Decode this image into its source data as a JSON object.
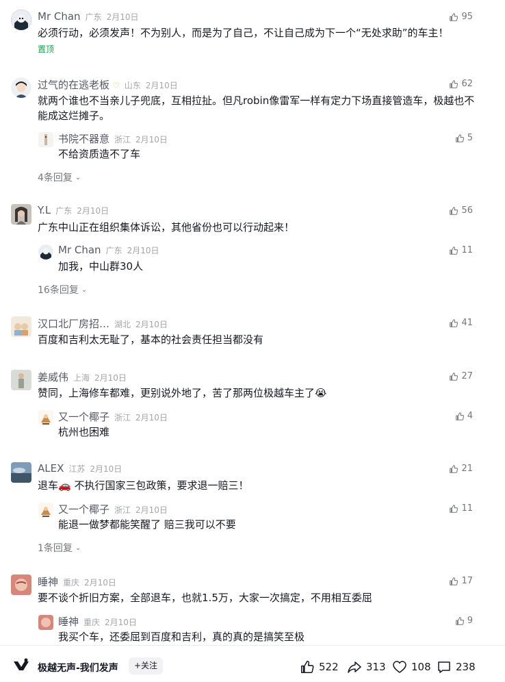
{
  "comments": [
    {
      "name": "Mr Chan",
      "location": "广东",
      "date": "2月10日",
      "likes": "95",
      "text": "必须行动，必须发声！不为别人，而是为了自己，不让自己成为下一个“无处求助”的车主！",
      "pinned": "置顶"
    },
    {
      "name": "过气的在逃老板",
      "location": "山东",
      "date": "2月10日",
      "likes": "62",
      "text": "就两个谁也不当亲儿子兜底，互相拉扯。但凡robin像雷军一样有定力下场直接管造车，极越也不能成这烂摊子。",
      "reply": {
        "name": "书院不器意",
        "location": "浙江",
        "date": "2月10日",
        "likes": "5",
        "text": "不给资质造不了车"
      },
      "more": "4条回复"
    },
    {
      "name": "Y.L",
      "location": "广东",
      "date": "2月10日",
      "likes": "56",
      "text": "广东中山正在组织集体诉讼，其他省份也可以行动起来！",
      "reply": {
        "name": "Mr Chan",
        "location": "广东",
        "date": "2月10日",
        "likes": "11",
        "text": "加我，中山群30人"
      },
      "more": "16条回复"
    },
    {
      "name": "汉口北厂房招…",
      "location": "湖北",
      "date": "2月10日",
      "likes": "41",
      "text": "百度和吉利太无耻了，基本的社会责任担当都没有"
    },
    {
      "name": "姜威伟",
      "location": "上海",
      "date": "2月10日",
      "likes": "27",
      "text": "赞同，上海修车都难，更别说外地了，苦了那两位极越车主了😭",
      "reply": {
        "name": "又一个椰子",
        "location": "浙江",
        "date": "2月10日",
        "likes": "4",
        "text": "杭州也困难"
      }
    },
    {
      "name": "ALEX",
      "location": "江苏",
      "date": "2月10日",
      "likes": "21",
      "text": "退车🚗 不执行国家三包政策，要求退一赔三！",
      "reply": {
        "name": "又一个椰子",
        "location": "浙江",
        "date": "2月10日",
        "likes": "11",
        "text": "能退一做梦都能笑醒了 赔三我可以不要"
      },
      "more": "1条回复"
    },
    {
      "name": "睡神",
      "location": "重庆",
      "date": "2月10日",
      "likes": "17",
      "text": "要不谈个折旧方案，全部退车，也就1.5万，大家一次搞定，不用相互委屈",
      "reply": {
        "name": "睡神",
        "location": "重庆",
        "date": "2月10日",
        "likes": "9",
        "text": "我买个车，还委屈到百度和吉利，真的真的是搞笑至极"
      }
    }
  ],
  "bottom_bar": {
    "title": "极越无声-我们发声",
    "follow_label": "+关注",
    "likes": "522",
    "shares": "313",
    "favorites": "108",
    "comments": "238"
  },
  "colors": {
    "pinned_green": "#0fa84a",
    "meta_gray": "#a3a5ab",
    "name_gray": "#555866"
  },
  "icons": [
    "thumb-up-icon",
    "chevron-down-icon",
    "share-icon",
    "heart-icon",
    "comment-icon",
    "app-logo-icon"
  ]
}
